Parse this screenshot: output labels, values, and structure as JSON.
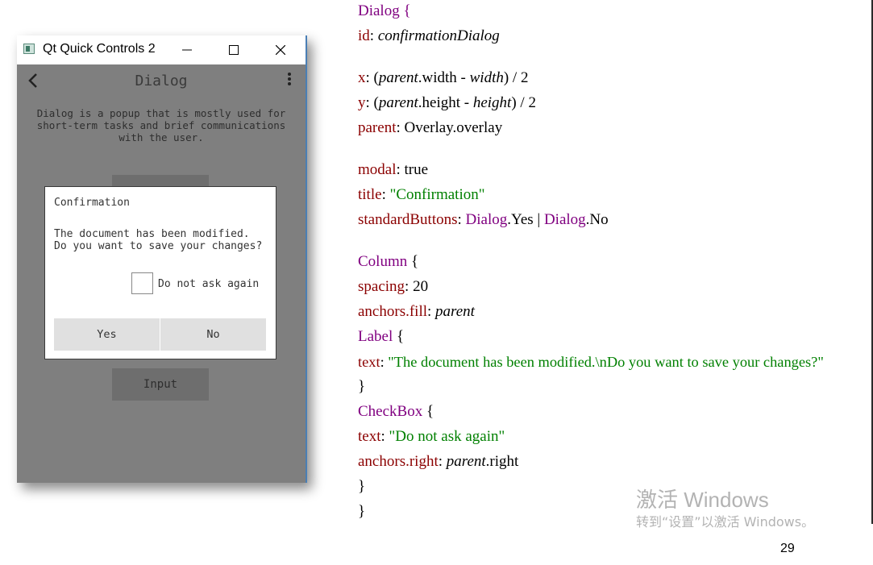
{
  "window": {
    "title": "Qt Quick Controls 2"
  },
  "app": {
    "toolbar_title": "Dialog",
    "description": "Dialog is a popup that is mostly used for\nshort-term tasks and brief communications\nwith the user.",
    "input_button": "Input"
  },
  "dialog": {
    "title": "Confirmation",
    "message": "The document has been modified.\nDo you want to save your changes?",
    "checkbox_label": "Do not ask again",
    "checkbox_checked": false,
    "yes_label": "Yes",
    "no_label": "No"
  },
  "code": {
    "l1_type": "Dialog",
    "l1_brace": " {",
    "l2_prop": "id",
    "l2_value": "confirmationDialog",
    "l3_prop": "x",
    "l3_parent": "parent",
    "l3_mid": ".width - ",
    "l3_width": "width",
    "l3_end": ") / 2",
    "l4_prop": "y",
    "l4_parent": "parent",
    "l4_mid": ".height - ",
    "l4_height": "height",
    "l4_end": ") / 2",
    "l5_prop": "parent",
    "l5_value": "Overlay.overlay",
    "l6_prop": "modal",
    "l6_value": "true",
    "l7_prop": "title",
    "l7_value": "\"Confirmation\"",
    "l8_prop": "standardButtons",
    "l8_type1": "Dialog",
    "l8_val1": ".Yes | ",
    "l8_type2": "Dialog",
    "l8_val2": ".No",
    "l9_type": "Column",
    "l9_brace": " {",
    "l10_prop": "spacing",
    "l10_value": "20",
    "l11_prop": "anchors.fill",
    "l11_value": "parent",
    "l12_type": "Label",
    "l12_brace": " {",
    "l13_prop": "text",
    "l13_value": "\"The document has been modified.\\nDo you want to save your changes?\"",
    "l14": "}",
    "l15_type": "CheckBox",
    "l15_brace": " {",
    "l16_prop": "text",
    "l16_value": "\"Do not ask again\"",
    "l17_prop": "anchors.right",
    "l17_parent": "parent",
    "l17_end": ".right",
    "l18": "}",
    "l19": "}"
  },
  "watermark": {
    "title": "激活 Windows",
    "subtitle": "转到“设置”以激活 Windows。"
  },
  "page_number": "29",
  "colors": {
    "keyword": "#800080",
    "property": "#8b0000",
    "string": "#008000",
    "window_bg": "#7f7f7f"
  },
  "icons": [
    "app-icon",
    "minimize-icon",
    "maximize-icon",
    "close-icon",
    "back-arrow-icon",
    "more-vert-icon"
  ]
}
